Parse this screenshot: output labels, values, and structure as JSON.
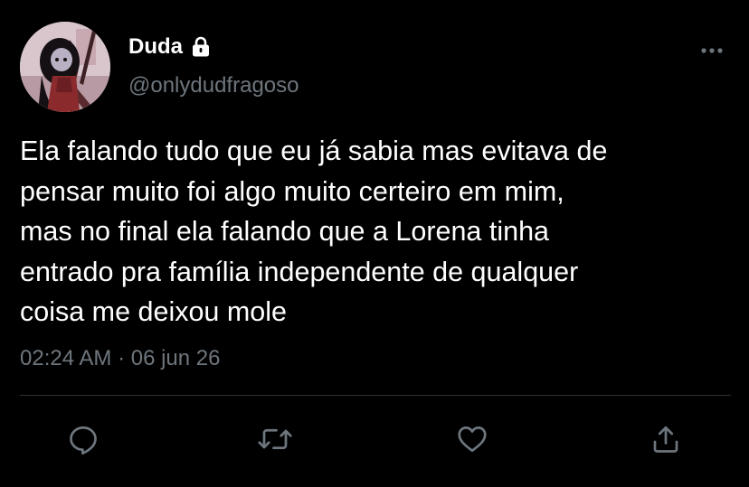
{
  "tweet": {
    "display_name": "Duda",
    "handle": "@onlydudfragoso",
    "text_lines": [
      "Ela falando tudo que eu já sabia mas evitava de",
      "pensar muito foi algo muito certeiro em mim,",
      "mas no final ela falando que a Lorena tinha",
      "entrado pra família independente de qualquer",
      "coisa me deixou mole"
    ],
    "timestamp": "02:24 AM · 06 jun 26"
  },
  "icons": {
    "protected": "lock-icon",
    "more": "more-horizontal-icon",
    "reply": "reply-icon",
    "retweet": "retweet-icon",
    "like": "heart-icon",
    "share": "share-icon"
  },
  "colors": {
    "background": "#000000",
    "text": "#ffffff",
    "secondary": "#6e767d",
    "divider": "#2f3336"
  }
}
